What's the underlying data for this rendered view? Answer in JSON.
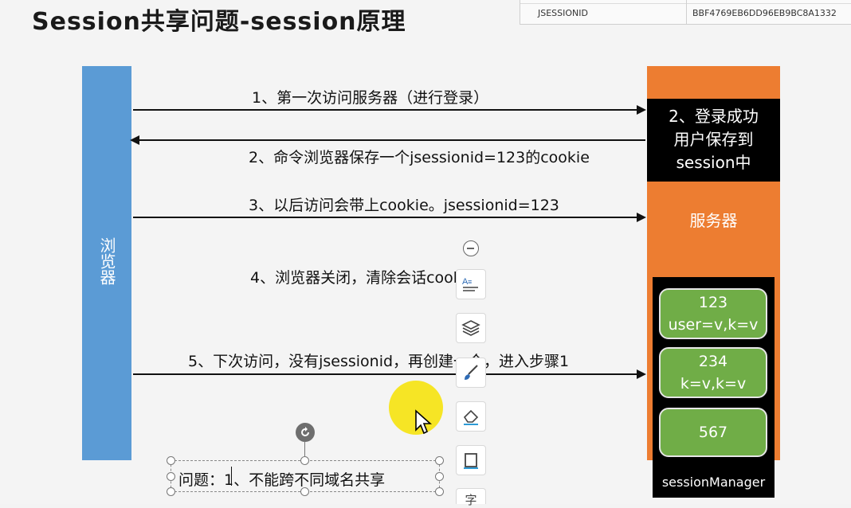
{
  "title": "Session共享问题-session原理",
  "cookie_panel": {
    "name": "JSESSIONID",
    "value": "BBF4769EB6DD96EB9BC8A1332"
  },
  "browser_label": "浏览器",
  "server": {
    "login_lines": [
      "2、登录成功",
      "用户保存到",
      "session中"
    ],
    "label": "服务器"
  },
  "session_manager": {
    "label": "sessionManager",
    "items": [
      {
        "line1": "123",
        "line2": "user=v,k=v"
      },
      {
        "line1": "234",
        "line2": "k=v,k=v"
      },
      {
        "line1": "567",
        "line2": ""
      }
    ]
  },
  "steps": [
    "1、第一次访问服务器（进行登录）",
    "2、命令浏览器保存一个jsessionid=123的cookie",
    "3、以后访问会带上cookie。jsessionid=123",
    "4、浏览器关闭，清除会话cookie",
    "5、下次访问，没有jsessionid，再创建一个，进入步骤1"
  ],
  "textbox": "问题：1、不能跨不同域名共享",
  "toolbar": {
    "icons": [
      "collapse-icon",
      "text-format-icon",
      "layers-icon",
      "brush-icon",
      "eraser-icon",
      "frame-icon",
      "text-icon"
    ],
    "partial_label": "字"
  },
  "colors": {
    "browser": "#5b9bd5",
    "server": "#ed7d31",
    "session_item": "#70ad47",
    "highlight": "#f6e200"
  }
}
